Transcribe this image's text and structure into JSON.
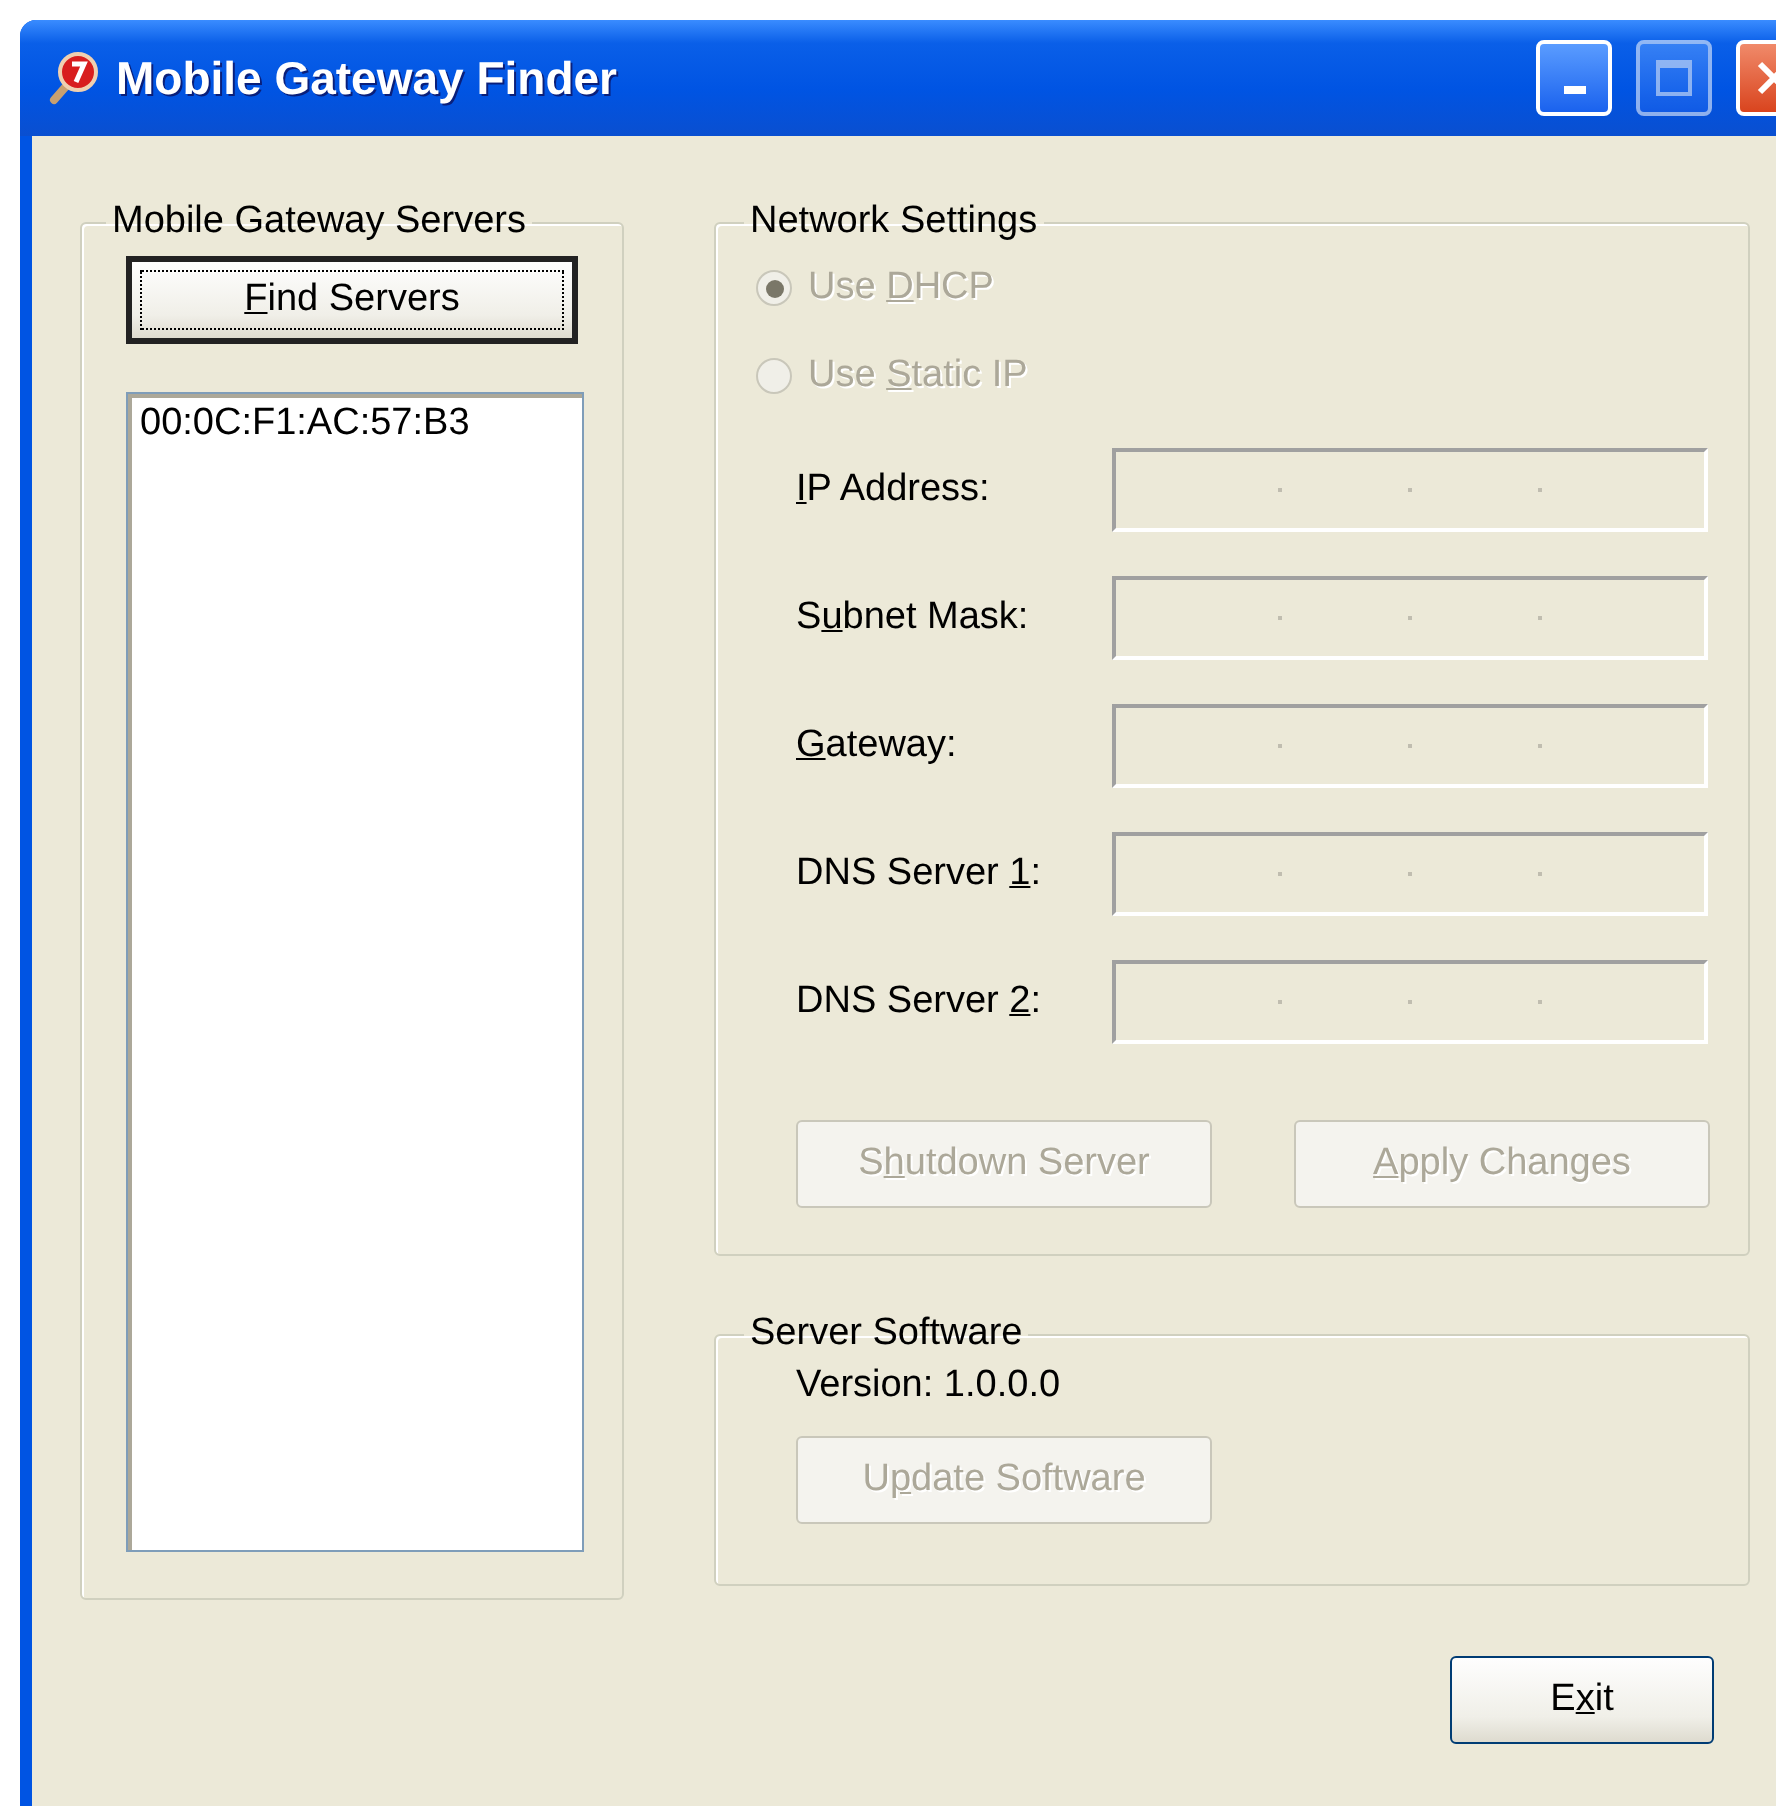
{
  "window": {
    "title": "Mobile Gateway Finder"
  },
  "servers_group": {
    "title": "Mobile Gateway Servers",
    "find_button": {
      "label": {
        "key": "F",
        "after": "ind Servers"
      },
      "focused": true
    },
    "list": [
      {
        "text": "00:0C:F1:AC:57:B3",
        "selected": false
      }
    ]
  },
  "network_group": {
    "title": "Network Settings",
    "options": [
      {
        "label": {
          "before": "Use ",
          "key": "D",
          "after": "HCP"
        },
        "selected": true,
        "disabled": true
      },
      {
        "label": {
          "before": "Use ",
          "key": "S",
          "after": "tatic IP"
        },
        "selected": false,
        "disabled": true
      }
    ],
    "fields": [
      {
        "label": {
          "key": "I",
          "after": "P Address:"
        },
        "disabled": true
      },
      {
        "label": {
          "before": "S",
          "key": "u",
          "after": "bnet Mask:"
        },
        "disabled": true
      },
      {
        "label": {
          "key": "G",
          "after": "ateway:"
        },
        "disabled": true
      },
      {
        "label": {
          "before": "DNS Server ",
          "key": "1",
          "after": ":"
        },
        "disabled": true
      },
      {
        "label": {
          "before": "DNS Server ",
          "key": "2",
          "after": ":"
        },
        "disabled": true
      }
    ],
    "buttons": [
      {
        "label": {
          "before": "S",
          "key": "h",
          "after": "utdown Server"
        },
        "disabled": true
      },
      {
        "label": {
          "key": "A",
          "after": "pply Changes"
        },
        "disabled": true
      }
    ]
  },
  "software_group": {
    "title": "Server Software",
    "version": "Version: 1.0.0.0",
    "button": {
      "label": {
        "before": "U",
        "key": "p",
        "after": "date Software"
      },
      "disabled": true
    }
  },
  "exit_button": {
    "label": {
      "before": "E",
      "key": "x",
      "after": "it"
    },
    "disabled": false
  }
}
